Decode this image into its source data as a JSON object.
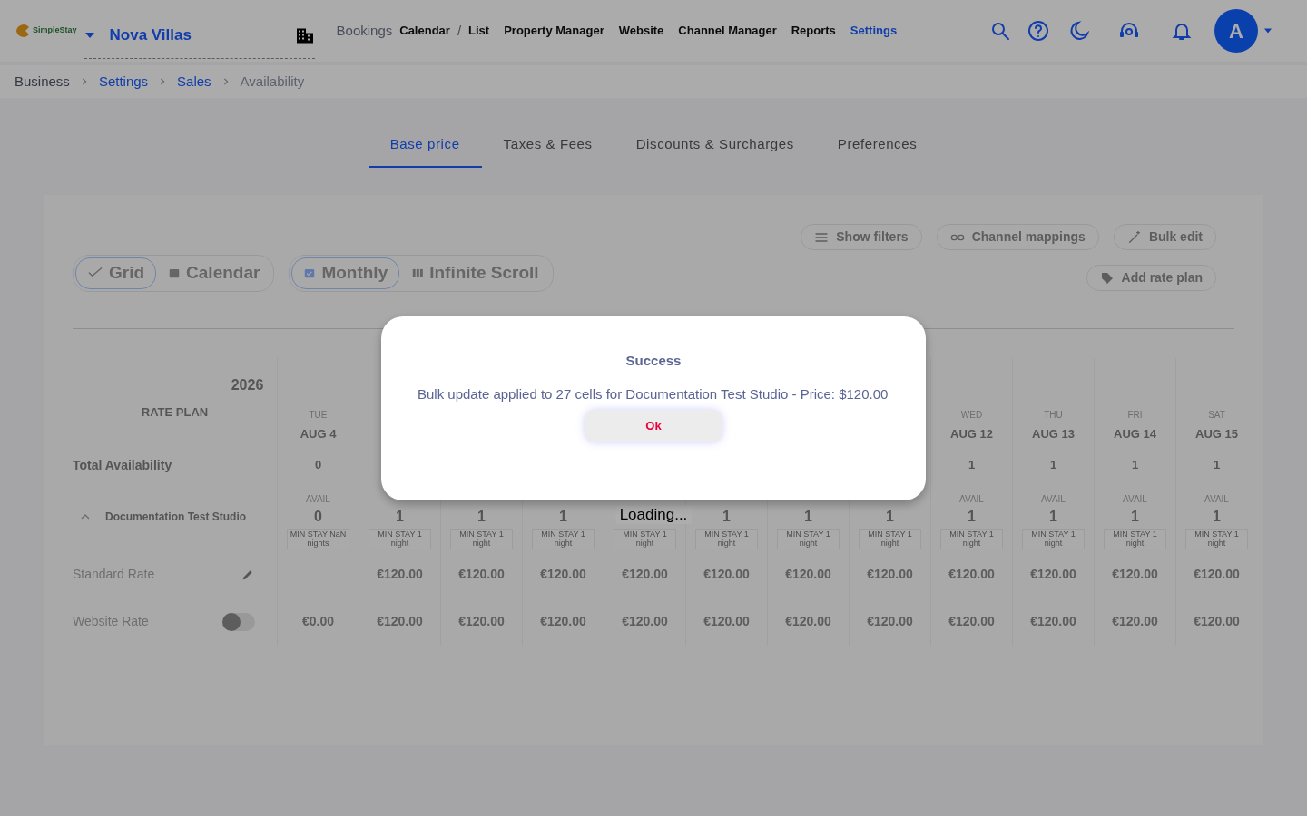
{
  "header": {
    "logo_text": "SimpleStay",
    "property": "Nova Villas",
    "bookings": {
      "label": "Bookings",
      "separator": "/",
      "links": [
        {
          "label": "Calendar"
        },
        {
          "label": "List"
        }
      ]
    },
    "nav": [
      {
        "label": "Property Manager",
        "selected": false
      },
      {
        "label": "Website",
        "selected": false
      },
      {
        "label": "Channel Manager",
        "selected": false
      },
      {
        "label": "Reports",
        "selected": false
      },
      {
        "label": "Settings",
        "selected": true
      }
    ],
    "avatar": "A"
  },
  "breadcrumbs": [
    {
      "label": "Business",
      "kind": "root"
    },
    {
      "label": "Settings",
      "kind": "link"
    },
    {
      "label": "Sales",
      "kind": "link"
    },
    {
      "label": "Availability",
      "kind": "current"
    }
  ],
  "tabs": [
    {
      "label": "Base price",
      "selected": true
    },
    {
      "label": "Taxes & Fees",
      "selected": false
    },
    {
      "label": "Discounts & Surcharges",
      "selected": false
    },
    {
      "label": "Preferences",
      "selected": false
    }
  ],
  "view_toggles": [
    {
      "label": "Grid",
      "selected": true
    },
    {
      "label": "Calendar",
      "selected": false
    }
  ],
  "mode_toggles": [
    {
      "label": "Monthly",
      "selected": true
    },
    {
      "label": "Infinite Scroll",
      "selected": false
    }
  ],
  "actions": [
    {
      "label": "Show filters",
      "kind": "filters"
    },
    {
      "label": "Channel mappings",
      "kind": "link"
    },
    {
      "label": "Bulk edit",
      "kind": "wand"
    }
  ],
  "add_action": {
    "label": "Add rate plan",
    "kind": "tag"
  },
  "table": {
    "year": "2026",
    "rate_plan_header": "RATE PLAN",
    "total_label": "Total Availability",
    "room": {
      "name": "Documentation Test Studio",
      "expanded": true
    },
    "columns": [
      {
        "day": "TUE",
        "date": "AUG 4",
        "total": "0",
        "avail_label": "AVAIL",
        "avail": "0",
        "min_stay_label": "MIN STAY",
        "min_stay": "NaN nights"
      },
      {
        "avail": "1",
        "min_stay_label": "MIN STAY",
        "min_stay": "1 night"
      },
      {
        "avail": "1",
        "min_stay_label": "MIN STAY",
        "min_stay": "1 night"
      },
      {
        "avail": "1",
        "min_stay_label": "MIN STAY",
        "min_stay": "1 night"
      },
      {
        "min_stay_label": "MIN STAY",
        "min_stay": "1 night"
      },
      {
        "avail": "1",
        "min_stay_label": "MIN STAY",
        "min_stay": "1 night"
      },
      {
        "avail": "1",
        "min_stay_label": "MIN STAY",
        "min_stay": "1 night"
      },
      {
        "avail": "1",
        "min_stay_label": "MIN STAY",
        "min_stay": "1 night"
      },
      {
        "day": "WED",
        "date": "AUG 12",
        "total": "1",
        "avail_label": "AVAIL",
        "avail": "1",
        "min_stay_label": "MIN STAY",
        "min_stay": "1 night"
      },
      {
        "day": "THU",
        "date": "AUG 13",
        "total": "1",
        "avail_label": "AVAIL",
        "avail": "1",
        "min_stay_label": "MIN STAY",
        "min_stay": "1 night"
      },
      {
        "day": "FRI",
        "date": "AUG 14",
        "total": "1",
        "avail_label": "AVAIL",
        "avail": "1",
        "min_stay_label": "MIN STAY",
        "min_stay": "1 night"
      },
      {
        "day": "SAT",
        "date": "AUG 15",
        "total": "1",
        "avail_label": "AVAIL",
        "avail": "1",
        "min_stay_label": "MIN STAY",
        "min_stay": "1 night"
      }
    ],
    "rates": [
      {
        "name": "Standard Rate",
        "kind": "editable",
        "leading_blank": true,
        "prices": [
          "€120.00",
          "€120.00",
          "€120.00",
          "€120.00",
          "€120.00",
          "€120.00",
          "€120.00",
          "€120.00",
          "€120.00",
          "€120.00",
          "€120.00"
        ]
      },
      {
        "name": "Website Rate",
        "kind": "toggle",
        "on": false,
        "prices": [
          "€0.00",
          "€120.00",
          "€120.00",
          "€120.00",
          "€120.00",
          "€120.00",
          "€120.00",
          "€120.00",
          "€120.00",
          "€120.00",
          "€120.00",
          "€120.00"
        ]
      }
    ]
  },
  "loading": "Loading...",
  "modal": {
    "title": "Success",
    "message": "Bulk update applied to 27 cells for Documentation Test Studio - Price: $120.00",
    "button": "Ok"
  }
}
